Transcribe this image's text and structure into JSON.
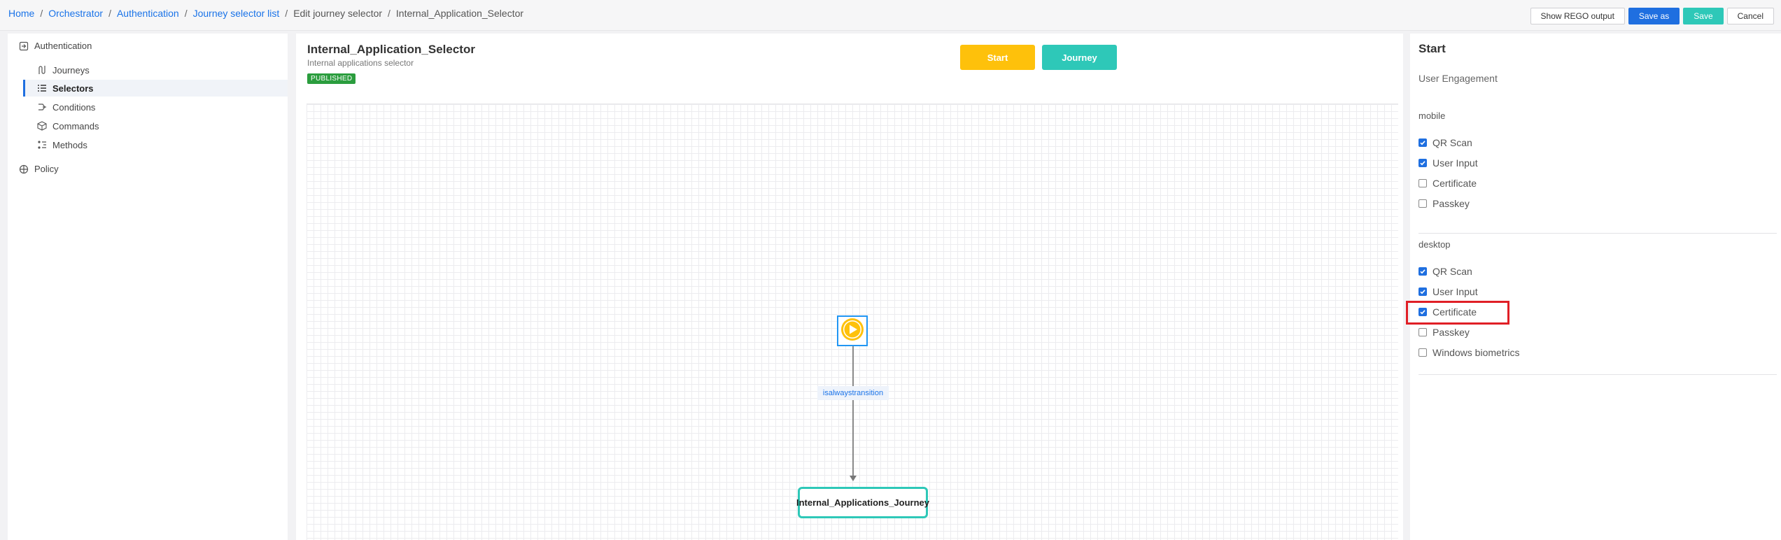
{
  "breadcrumb": {
    "items": [
      "Home",
      "Orchestrator",
      "Authentication",
      "Journey selector list",
      "Edit journey selector",
      "Internal_Application_Selector"
    ],
    "separator": "/"
  },
  "toolbar": {
    "show_rego": "Show REGO output",
    "save_as": "Save as",
    "save": "Save",
    "cancel": "Cancel"
  },
  "sidebar": {
    "section_auth": "Authentication",
    "items": [
      {
        "label": "Journeys",
        "icon": "journey-icon"
      },
      {
        "label": "Selectors",
        "icon": "selector-icon",
        "active": true
      },
      {
        "label": "Conditions",
        "icon": "conditions-icon"
      },
      {
        "label": "Commands",
        "icon": "commands-icon"
      },
      {
        "label": "Methods",
        "icon": "methods-icon"
      }
    ],
    "section_policy": "Policy"
  },
  "selector": {
    "title": "Internal_Application_Selector",
    "subtitle": "Internal applications selector",
    "status": "PUBLISHED"
  },
  "legend": {
    "start": "Start",
    "journey": "Journey",
    "start_color": "#fec10b",
    "journey_color": "#2ec8b8"
  },
  "diagram": {
    "start_node_icon": "play-icon",
    "edge_label": "isalwaystransition",
    "journey_node": "Internal_Applications_Journey"
  },
  "panel": {
    "title": "Start",
    "subtitle": "User Engagement",
    "mobile": {
      "label": "mobile",
      "options": [
        {
          "label": "QR Scan",
          "checked": true
        },
        {
          "label": "User Input",
          "checked": true
        },
        {
          "label": "Certificate",
          "checked": false
        },
        {
          "label": "Passkey",
          "checked": false
        }
      ]
    },
    "desktop": {
      "label": "desktop",
      "options": [
        {
          "label": "QR Scan",
          "checked": true
        },
        {
          "label": "User Input",
          "checked": true
        },
        {
          "label": "Certificate",
          "checked": true
        },
        {
          "label": "Passkey",
          "checked": false
        },
        {
          "label": "Windows biometrics",
          "checked": false
        }
      ]
    }
  }
}
